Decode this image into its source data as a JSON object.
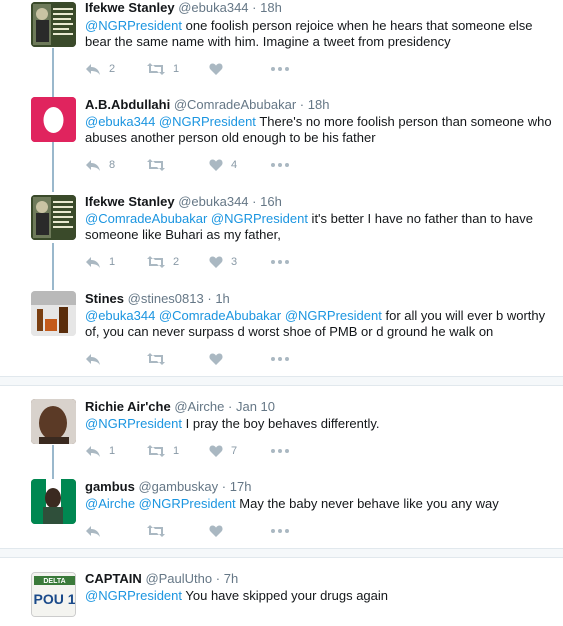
{
  "colors": {
    "link": "#1b95e0",
    "meta": "#657786",
    "icon": "#aab8c2",
    "thread": "#9ab8cc"
  },
  "tweets": [
    {
      "name": "Ifekwe Stanley",
      "handle": "@ebuka344",
      "dot": "·",
      "time": "18h",
      "mentions": "@NGRPresident",
      "text": " one foolish person rejoice when he hears that someone else bear the same name with him. Imagine a tweet from presidency",
      "reply_count": "2",
      "retweet_count": "1",
      "like_count": ""
    },
    {
      "name": "A.B.Abdullahi",
      "handle": "@ComradeAbubakar",
      "dot": "·",
      "time": "18h",
      "mentions": "@ebuka344 @NGRPresident",
      "text": " There's no more foolish person than someone who abuses another person old enough to be his father",
      "reply_count": "8",
      "retweet_count": "",
      "like_count": "4"
    },
    {
      "name": "Ifekwe Stanley",
      "handle": "@ebuka344",
      "dot": "·",
      "time": "16h",
      "mentions": "@ComradeAbubakar @NGRPresident",
      "text": " it's better I have no father than to have someone like Buhari as my father,",
      "reply_count": "1",
      "retweet_count": "2",
      "like_count": "3"
    },
    {
      "name": "Stines",
      "handle": "@stines0813",
      "dot": "·",
      "time": "1h",
      "mentions": "@ebuka344 @ComradeAbubakar @NGRPresident",
      "text": " for all you will ever b worthy of, you can never surpass d worst shoe of PMB or d ground he walk on",
      "reply_count": "",
      "retweet_count": "",
      "like_count": ""
    },
    {
      "name": "Richie Air'che",
      "handle": "@Airche",
      "dot": "·",
      "time": "Jan 10",
      "mentions": "@NGRPresident",
      "text": " I pray the boy behaves differently.",
      "reply_count": "1",
      "retweet_count": "1",
      "like_count": "7"
    },
    {
      "name": "gambus",
      "handle": "@gambuskay",
      "dot": "·",
      "time": "17h",
      "mentions": "@Airche @NGRPresident",
      "text": " May the baby never behave like you any way",
      "reply_count": "",
      "retweet_count": "",
      "like_count": ""
    },
    {
      "name": "CAPTAIN",
      "handle": "@PaulUtho",
      "dot": "·",
      "time": "7h",
      "mentions": "@NGRPresident",
      "text": " You have skipped your drugs again",
      "reply_count": "",
      "retweet_count": "",
      "like_count": "",
      "avatar_text": "POU 1",
      "avatar_top": "DELTA"
    }
  ],
  "icons": {
    "reply": "reply-icon",
    "retweet": "retweet-icon",
    "like": "heart-icon",
    "more": "more-icon"
  }
}
